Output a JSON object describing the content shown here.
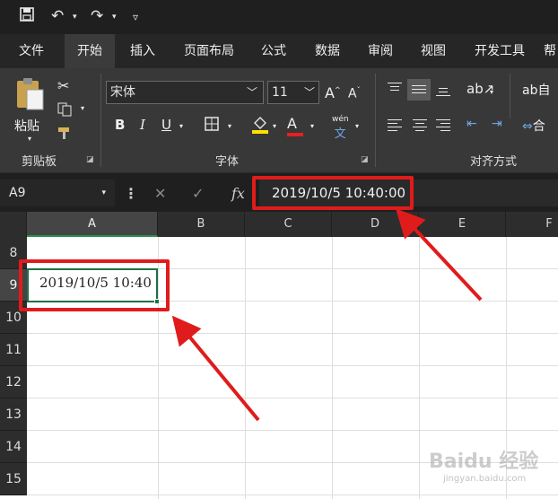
{
  "colors": {
    "accent_green": "#1e7145",
    "annotation_red": "#e01b1b"
  },
  "qat": {
    "save_icon": "save-icon",
    "undo_icon": "undo-icon",
    "redo_icon": "redo-icon",
    "customize_icon": "customize-qat-icon"
  },
  "tabs": [
    {
      "label": "文件"
    },
    {
      "label": "开始"
    },
    {
      "label": "插入"
    },
    {
      "label": "页面布局"
    },
    {
      "label": "公式"
    },
    {
      "label": "数据"
    },
    {
      "label": "审阅"
    },
    {
      "label": "视图"
    },
    {
      "label": "开发工具"
    },
    {
      "label": "帮"
    }
  ],
  "clipboard": {
    "paste_label": "粘贴",
    "group_label": "剪贴板"
  },
  "font": {
    "family": "宋体",
    "size": "11",
    "grow": "A",
    "shrink": "A",
    "bold": "B",
    "italic": "I",
    "underline": "U",
    "font_color": "A",
    "phonetic": "wén",
    "group_label": "字体"
  },
  "alignment": {
    "group_label": "对齐方式",
    "wrap_label": "自",
    "merge_label": "合"
  },
  "formula_bar": {
    "name_box": "A9",
    "fx_label": "fx",
    "formula": "2019/10/5  10:40:00"
  },
  "columns": [
    "A",
    "B",
    "C",
    "D",
    "E",
    "F"
  ],
  "rows": [
    "8",
    "9",
    "10",
    "11",
    "12",
    "13",
    "14",
    "15"
  ],
  "cell_a9": "2019/10/5  10:40",
  "watermark": {
    "text": "Baidu 经验",
    "sub": "jingyan.baidu.com"
  }
}
